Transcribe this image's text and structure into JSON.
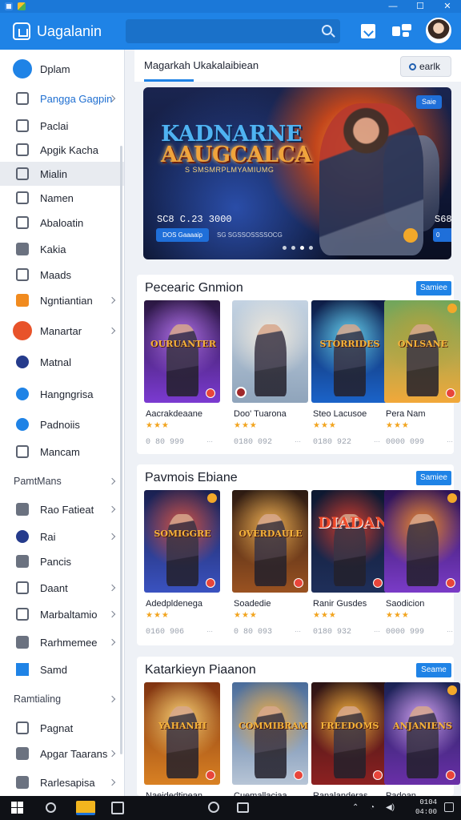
{
  "app": {
    "title": "Uagalanin",
    "search_placeholder": ""
  },
  "sidebar": {
    "items": [
      {
        "label": "Dplam",
        "icon": "menu-icon",
        "highlight": "blue"
      },
      {
        "label": "Pangga Gagpin",
        "icon": "home-icon",
        "blue": true,
        "chevron": true
      },
      {
        "label": "Paclai",
        "icon": "picture-icon"
      },
      {
        "label": "Apgik Kacha",
        "icon": "time-icon"
      },
      {
        "label": "Mialin",
        "icon": "square-icon",
        "active": true
      },
      {
        "label": "Namen",
        "icon": "list-icon"
      },
      {
        "label": "Abaloatin",
        "icon": "tablet-icon"
      },
      {
        "label": "Kakia",
        "icon": "tool-icon"
      },
      {
        "label": "Maads",
        "icon": "camera-icon"
      },
      {
        "label": "Ngntiantian",
        "icon": "orange-square-icon",
        "chevron": true
      },
      {
        "label": "Manartar",
        "icon": "red-circle-icon",
        "chevron": true
      },
      {
        "label": "Matnal",
        "icon": "navy-circle-icon"
      },
      {
        "label": "Hangngrisa",
        "icon": "blue-circle-icon"
      },
      {
        "label": "Padnoiis",
        "icon": "chat-icon"
      },
      {
        "label": "Mancam",
        "icon": "globe-icon"
      }
    ],
    "section_label": "PamtMans",
    "items2": [
      {
        "label": "Rao Fatieat",
        "icon": "pen-icon",
        "chevron": true
      },
      {
        "label": "Rai",
        "icon": "info-icon",
        "chevron": true
      },
      {
        "label": "Pancis",
        "icon": "tool2-icon"
      },
      {
        "label": "Daant",
        "icon": "doc-icon",
        "chevron": true
      },
      {
        "label": "Marbaltamio",
        "icon": "image-icon",
        "chevron": true
      },
      {
        "label": "Rarhmemee",
        "icon": "grid-icon",
        "chevron": true
      },
      {
        "label": "Samd",
        "icon": "blue-badge-icon"
      }
    ],
    "section_label2": "Ramtialing",
    "items3": [
      {
        "label": "Pagnat",
        "icon": "card-icon"
      },
      {
        "label": "Apgar Taarans",
        "icon": "bulb-icon",
        "chevron": true
      },
      {
        "label": "Rarlesapisa",
        "icon": "heart-icon",
        "chevron": true
      }
    ]
  },
  "tabs": {
    "active": "Magarkah Ukakalaibiean",
    "button": "earlk"
  },
  "hero": {
    "title_line1": "KADNARNE",
    "title_line2": "AAUGCALCA",
    "subtitle": "S SMSMRPLMYAMIUMG",
    "price_left": "SC8 C.23 3000",
    "price_right": "S68",
    "button_left": "DOS Gaaaaip",
    "button_right": "0",
    "meta": "SG SGSSOSSSSOCG",
    "badge": "Saie",
    "dots": 4,
    "active_dot": 3
  },
  "sections": [
    {
      "title": "Pecearic Gnmion",
      "button": "Samiee",
      "games": [
        {
          "name": "Aacrakdeaane",
          "stars": "★★★",
          "price": "0 80 999",
          "cover_title": "OURUANTER",
          "bg": [
            "#2a1740",
            "#7b3ad1",
            "#ad6fe3"
          ]
        },
        {
          "name": "Doo' Tuarona",
          "stars": "★★★",
          "price": "0180 092",
          "cover_title": "",
          "bg": [
            "#c4d3e2",
            "#8fa4bb",
            "#f2eadd"
          ]
        },
        {
          "name": "Steo Lacusoe",
          "stars": "★★★",
          "price": "0180 922",
          "cover_title": "STORRIDES",
          "bg": [
            "#0e1c44",
            "#1b63c9",
            "#66d2ef"
          ]
        },
        {
          "name": "Pera Nam",
          "stars": "★★★",
          "price": "0000 099",
          "cover_title": "ONLSANE",
          "bg": [
            "#6fa65c",
            "#f2a83a",
            "#b0a23d"
          ]
        }
      ]
    },
    {
      "title": "Pavmois Ebiane",
      "button": "Samiee",
      "games": [
        {
          "name": "Adedpldenega",
          "stars": "★★★",
          "price": "0160 906",
          "cover_title": "SOMIGGRE",
          "bg": [
            "#1a2050",
            "#3a52c0",
            "#d35242"
          ]
        },
        {
          "name": "Soadedie",
          "stars": "★★★",
          "price": "0 80 093",
          "cover_title": "OVERDAULE",
          "bg": [
            "#2b1a12",
            "#9a5221",
            "#f0b153"
          ]
        },
        {
          "name": "Ranir Gusdes",
          "stars": "★★★",
          "price": "0180 932",
          "cover_title": "DIADAN",
          "bg": [
            "#0d1830",
            "#1f2f5a",
            "#d43c2a"
          ]
        },
        {
          "name": "Saodicion",
          "stars": "★★★",
          "price": "0000 999",
          "cover_title": "",
          "bg": [
            "#2c1356",
            "#7a3bc7",
            "#ef8a2a"
          ]
        }
      ]
    },
    {
      "title": "Katarkieyn Piaanon",
      "button": "Seame",
      "games": [
        {
          "name": "Naeidedtinean",
          "stars": "",
          "price": "",
          "cover_title": "YAHANHI",
          "bg": [
            "#7f3311",
            "#d98123",
            "#f6cf73"
          ]
        },
        {
          "name": "Cuemallaciaa",
          "stars": "",
          "price": "",
          "cover_title": "COMMIBRAM",
          "bg": [
            "#4a6c9a",
            "#b7c5d6",
            "#e6a94a"
          ]
        },
        {
          "name": "Ranalanderas",
          "stars": "",
          "price": "",
          "cover_title": "FREEDOMS",
          "bg": [
            "#2b1415",
            "#8d2121",
            "#f5b23c"
          ]
        },
        {
          "name": "Padoan",
          "stars": "",
          "price": "",
          "cover_title": "ANJANIENS",
          "bg": [
            "#1a2354",
            "#6a2fa8",
            "#d0a1f0"
          ]
        }
      ]
    }
  ],
  "taskbar": {
    "clock_time": "0104",
    "clock_date": "04:00"
  }
}
